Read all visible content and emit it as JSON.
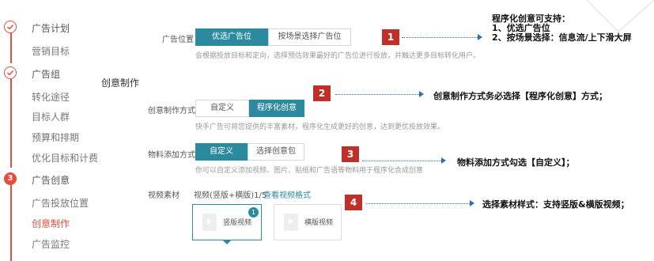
{
  "sidebar": {
    "steps": [
      {
        "label": "广告计划"
      },
      {
        "label": "营销目标"
      },
      {
        "label": "广告组"
      },
      {
        "label": "转化途径"
      },
      {
        "label": "目标人群"
      },
      {
        "label": "预算和排期"
      },
      {
        "label": "优化目标和计费"
      },
      {
        "label": "广告创意",
        "number": "3"
      },
      {
        "label": "广告投放位置"
      },
      {
        "label": "创意制作"
      },
      {
        "label": "广告监控"
      }
    ]
  },
  "form": {
    "ad_position": {
      "label": "广告位置",
      "options": [
        "优选广告位",
        "按场景选择广告位"
      ],
      "hint": "会根据投放目标和定向，选择预估效果最好的广告位进行投放，并触达更多目标转化用户。"
    },
    "section_title": "创意制作",
    "creative_mode": {
      "label": "创意制作方式",
      "options": [
        "自定义",
        "程序化创意"
      ],
      "hint": "快手广告可将您提供的丰富素材，程序化生成更好的创意，达到更优投放效果。"
    },
    "material_mode": {
      "label": "物料添加方式",
      "options": [
        "自定义",
        "选择创意包"
      ],
      "hint": "你可以自定义添加视频、图片、贴纸和广告语等物料用于程序化合成创意"
    },
    "video": {
      "label": "视频素材",
      "count_text": "视频(竖版+横版)1/5",
      "link": "查看视频格式",
      "cards": [
        {
          "label": "竖版视频",
          "badge": "1"
        },
        {
          "label": "横版视频"
        }
      ]
    }
  },
  "annotations": {
    "badges": [
      "1",
      "2",
      "3",
      "4"
    ],
    "note1": {
      "title": "程序化创意可支持：",
      "line1": "1、优选广告位",
      "line2": "2、按场景选择：信息流/上下滑大屏"
    },
    "note2": "创意制作方式务必选择【程序化创意】方式；",
    "note3": "物料添加方式勾选【自定义】；",
    "note4": "选择素材样式：支持竖版&横版视频；"
  },
  "colors": {
    "accent": "#e74c3c",
    "teal": "#2b8a9e",
    "badge": "#c0302a",
    "arrow": "#2f6fb0"
  }
}
